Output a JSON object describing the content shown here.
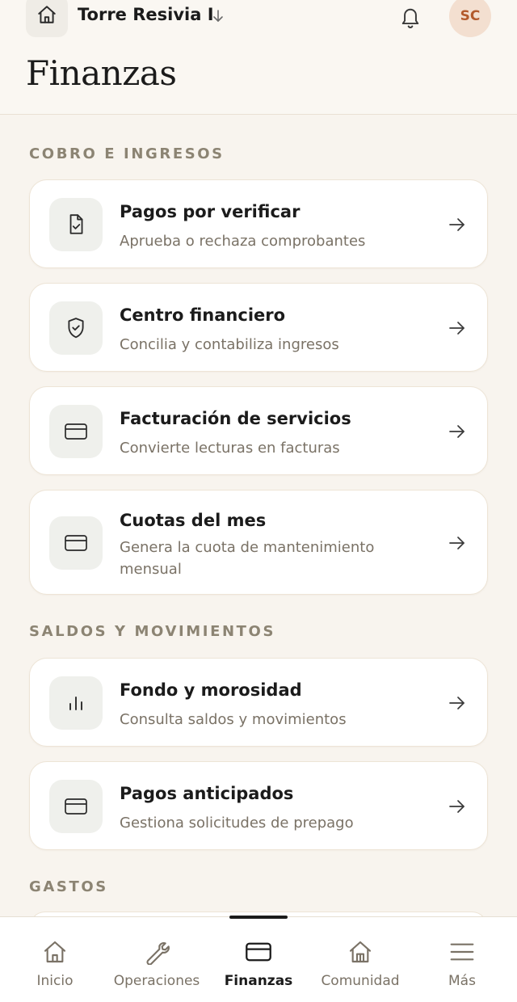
{
  "header": {
    "building": "Torre Resivia I",
    "avatar_initials": "SC",
    "page_title": "Finanzas"
  },
  "sections": [
    {
      "title": "COBRO E INGRESOS",
      "cards": [
        {
          "title": "Pagos por verificar",
          "subtitle": "Aprueba o rechaza comprobantes",
          "icon": "document-check-icon"
        },
        {
          "title": "Centro financiero",
          "subtitle": "Concilia y contabiliza ingresos",
          "icon": "shield-check-icon"
        },
        {
          "title": "Facturación de servicios",
          "subtitle": "Convierte lecturas en facturas",
          "icon": "credit-card-icon"
        },
        {
          "title": "Cuotas del mes",
          "subtitle": "Genera la cuota de mantenimiento mensual",
          "icon": "credit-card-icon"
        }
      ]
    },
    {
      "title": "SALDOS Y MOVIMIENTOS",
      "cards": [
        {
          "title": "Fondo y morosidad",
          "subtitle": "Consulta saldos y movimientos",
          "icon": "bar-chart-icon"
        },
        {
          "title": "Pagos anticipados",
          "subtitle": "Gestiona solicitudes de prepago",
          "icon": "credit-card-icon"
        }
      ]
    },
    {
      "title": "GASTOS",
      "cards": []
    }
  ],
  "tabbar": {
    "active": "Finanzas",
    "items": [
      {
        "label": "Inicio",
        "icon": "home-icon"
      },
      {
        "label": "Operaciones",
        "icon": "wrench-icon"
      },
      {
        "label": "Finanzas",
        "icon": "credit-card-icon"
      },
      {
        "label": "Comunidad",
        "icon": "building-icon"
      },
      {
        "label": "Más",
        "icon": "menu-icon"
      }
    ]
  },
  "colors": {
    "background": "#f8f4ee",
    "card": "#ffffff",
    "section_label": "#8c8473",
    "avatar_bg": "#f3dfd0",
    "avatar_text": "#b35a2c"
  }
}
